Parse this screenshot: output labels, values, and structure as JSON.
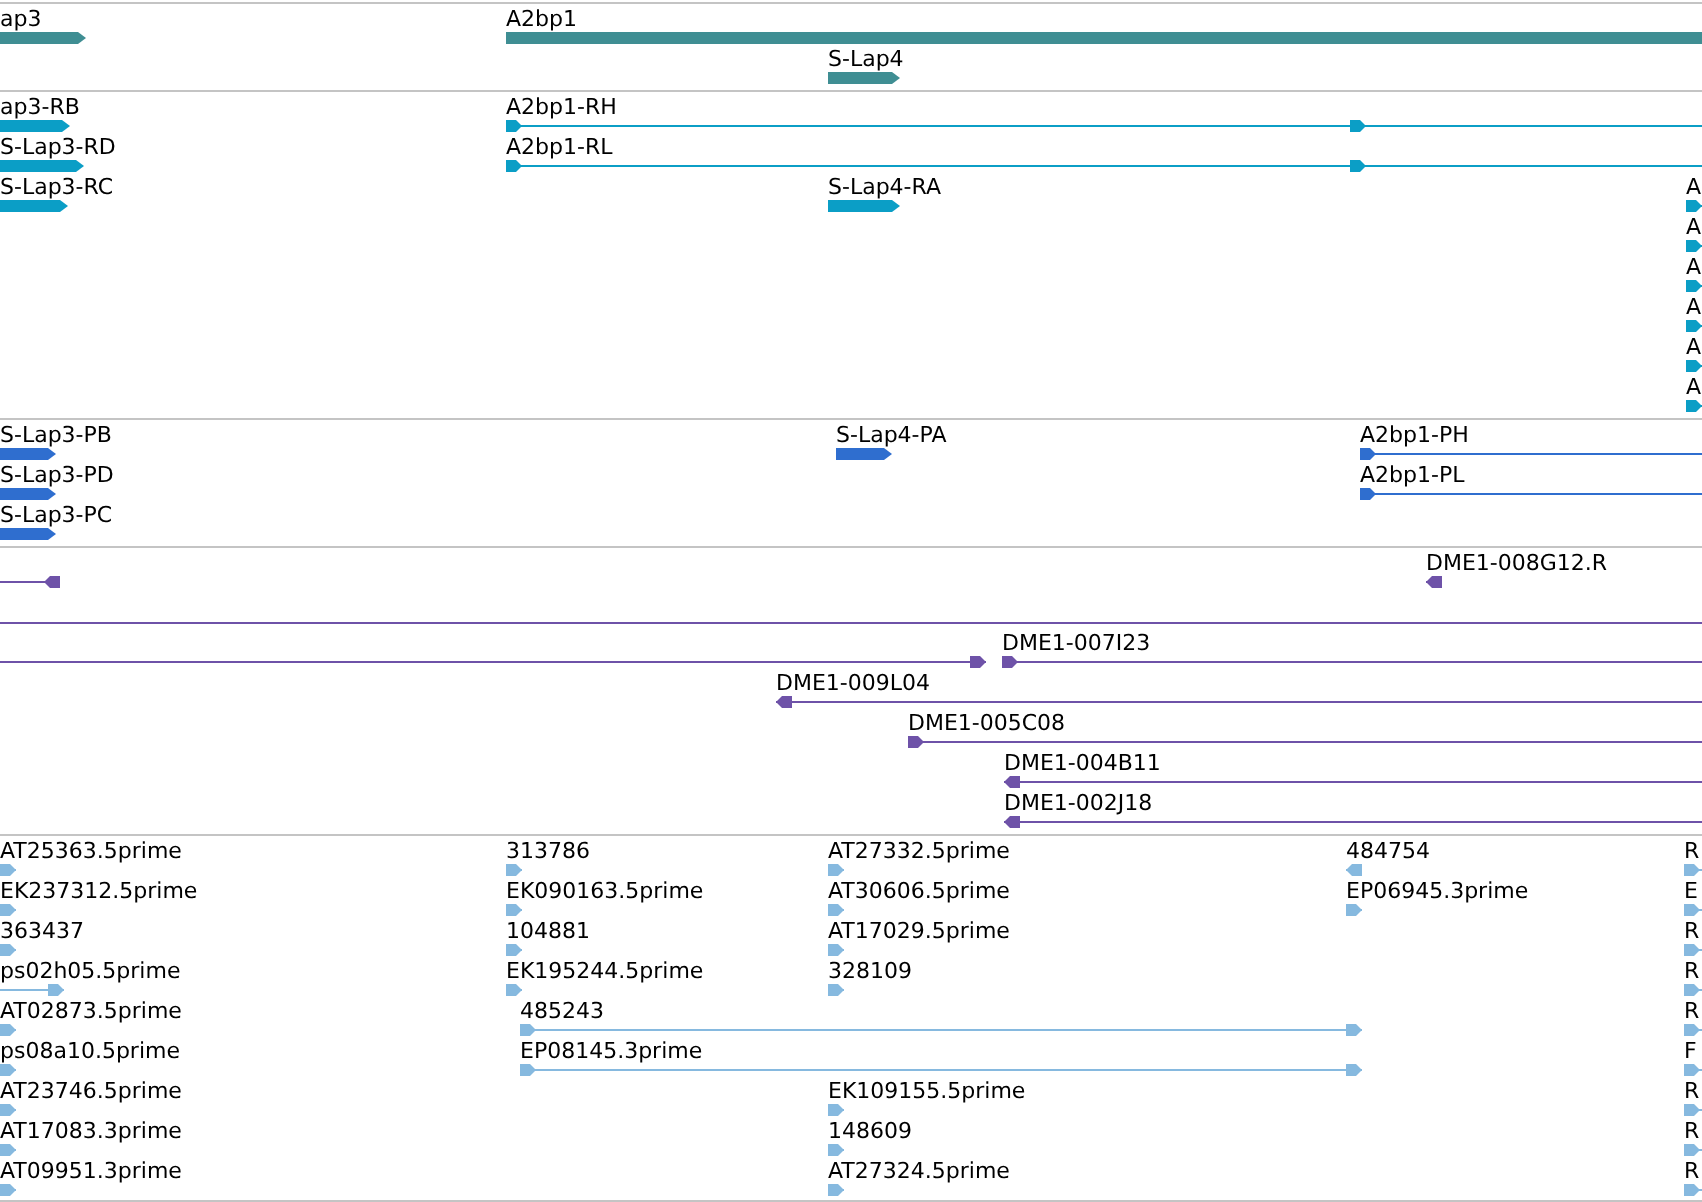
{
  "tracks": [
    {
      "kind": "gene",
      "features": [
        {
          "label": "ap3",
          "reverse": false
        },
        {
          "label": "A2bp1",
          "reverse": false
        },
        {
          "label": "S-Lap4",
          "reverse": false
        }
      ]
    },
    {
      "kind": "transcript",
      "features": [
        {
          "label": "ap3-RB",
          "reverse": false
        },
        {
          "label": "S-Lap3-RD",
          "reverse": false
        },
        {
          "label": "S-Lap3-RC",
          "reverse": false
        },
        {
          "label": "A2bp1-RH",
          "reverse": false
        },
        {
          "label": "A2bp1-RL",
          "reverse": false
        },
        {
          "label": "S-Lap4-RA",
          "reverse": false
        },
        {
          "label": "A",
          "reverse": false
        },
        {
          "label": "A",
          "reverse": false
        },
        {
          "label": "A",
          "reverse": false
        },
        {
          "label": "A",
          "reverse": false
        },
        {
          "label": "A",
          "reverse": false
        },
        {
          "label": "A",
          "reverse": false
        }
      ]
    },
    {
      "kind": "protein",
      "features": [
        {
          "label": "S-Lap3-PB",
          "reverse": false
        },
        {
          "label": "S-Lap3-PD",
          "reverse": false
        },
        {
          "label": "S-Lap3-PC",
          "reverse": false
        },
        {
          "label": "S-Lap4-PA",
          "reverse": false
        },
        {
          "label": "A2bp1-PH",
          "reverse": false
        },
        {
          "label": "A2bp1-PL",
          "reverse": false
        }
      ]
    },
    {
      "kind": "clone",
      "features": [
        {
          "reverse": true
        },
        {
          "label": "DME1-008G12.R",
          "reverse": true
        },
        {
          "reverse": false
        },
        {
          "label": "DME1-007I23",
          "reverse": false
        },
        {
          "label": "DME1-009L04",
          "reverse": true
        },
        {
          "label": "DME1-005C08",
          "reverse": false
        },
        {
          "label": "DME1-004B11",
          "reverse": true
        },
        {
          "label": "DME1-002J18",
          "reverse": true
        }
      ]
    },
    {
      "kind": "est",
      "features": [
        {
          "label": "AT25363.5prime",
          "reverse": false
        },
        {
          "label": "EK237312.5prime",
          "reverse": false
        },
        {
          "label": "363437",
          "reverse": false
        },
        {
          "label": "ps02h05.5prime",
          "reverse": false
        },
        {
          "label": "AT02873.5prime",
          "reverse": false
        },
        {
          "label": "ps08a10.5prime",
          "reverse": false
        },
        {
          "label": "AT23746.5prime",
          "reverse": false
        },
        {
          "label": "AT17083.3prime",
          "reverse": false
        },
        {
          "label": "AT09951.3prime",
          "reverse": false
        },
        {
          "label": "313786",
          "reverse": false
        },
        {
          "label": "EK090163.5prime",
          "reverse": false
        },
        {
          "label": "104881",
          "reverse": false
        },
        {
          "label": "EK195244.5prime",
          "reverse": false
        },
        {
          "label": "485243",
          "reverse": false
        },
        {
          "label": "EP08145.3prime",
          "reverse": false
        },
        {
          "label": "AT27332.5prime",
          "reverse": false
        },
        {
          "label": "AT30606.5prime",
          "reverse": false
        },
        {
          "label": "AT17029.5prime",
          "reverse": false
        },
        {
          "label": "328109",
          "reverse": false
        },
        {
          "label": "EK109155.5prime",
          "reverse": false
        },
        {
          "label": "148609",
          "reverse": false
        },
        {
          "label": "AT27324.5prime",
          "reverse": false
        },
        {
          "label": "484754",
          "reverse": true
        },
        {
          "label": "EP06945.3prime",
          "reverse": false
        },
        {
          "label": "R",
          "reverse": false
        },
        {
          "label": "E",
          "reverse": false
        },
        {
          "label": "R",
          "reverse": false
        },
        {
          "label": "R",
          "reverse": false
        },
        {
          "label": "R",
          "reverse": false
        },
        {
          "label": "F",
          "reverse": false
        },
        {
          "label": "R",
          "reverse": false
        },
        {
          "label": "R",
          "reverse": false
        },
        {
          "label": "R",
          "reverse": false
        }
      ]
    }
  ]
}
